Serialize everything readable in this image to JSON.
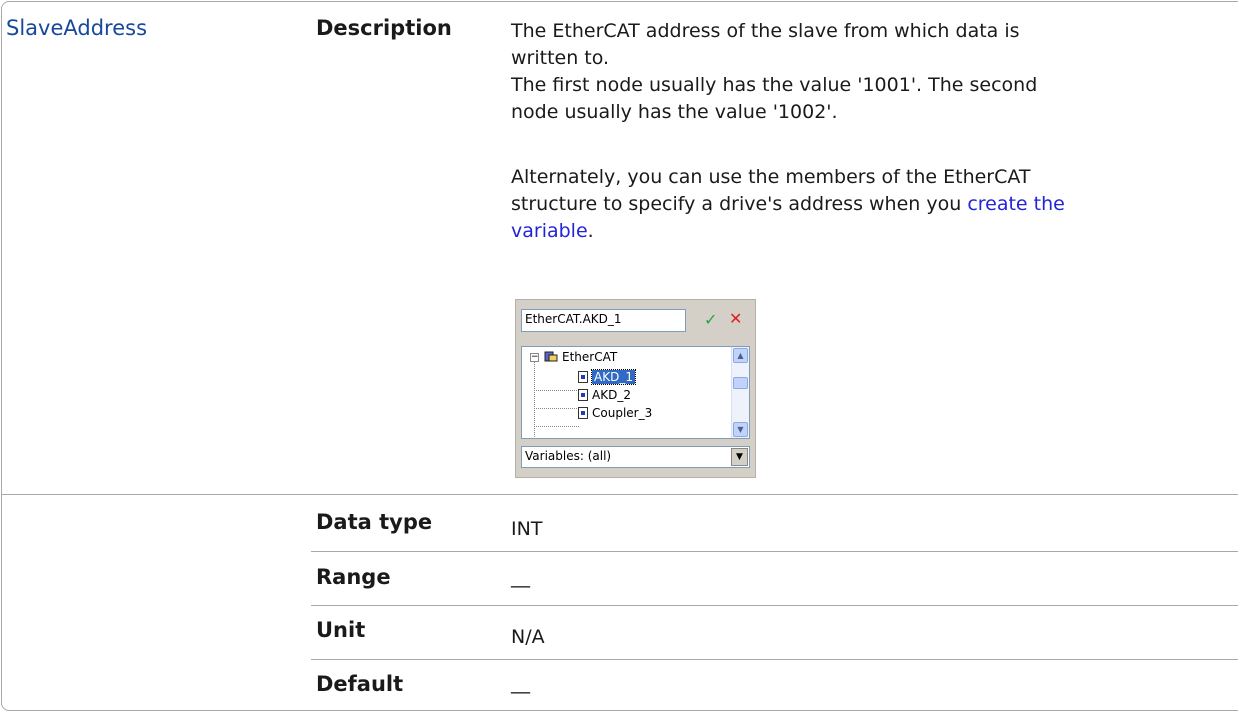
{
  "parameter": {
    "name": "SlaveAddress"
  },
  "labels": {
    "description": "Description",
    "data_type": "Data type",
    "range": "Range",
    "unit": "Unit",
    "default": "Default"
  },
  "description": {
    "line1": "The EtherCAT address of the slave from which data is",
    "line2": "written to.",
    "line3": "The first node usually has the value '1001'. The second",
    "line4": "node usually has the value '1002'.",
    "alt_line1": "Alternately, you can use the members of the EtherCAT",
    "alt_line2_prefix": "structure to specify a drive's address when you ",
    "alt_link_part1": "create the",
    "alt_link_part2": "variable",
    "alt_suffix": "."
  },
  "values": {
    "data_type": "INT",
    "range": "__",
    "unit": "N/A",
    "default": "__"
  },
  "widget": {
    "input_value": "EtherCAT.AKD_1",
    "ok_glyph": "✓",
    "cancel_glyph": "✕",
    "tree_root": "EtherCAT",
    "tree_items": [
      "AKD_1",
      "AKD_2",
      "Coupler_3"
    ],
    "selected_item": "AKD_1",
    "filter_value": "Variables: (all)",
    "expander_glyph": "−"
  },
  "colors": {
    "param_name": "#17489a",
    "link": "#2323d9",
    "border": "#a9a9a9"
  }
}
